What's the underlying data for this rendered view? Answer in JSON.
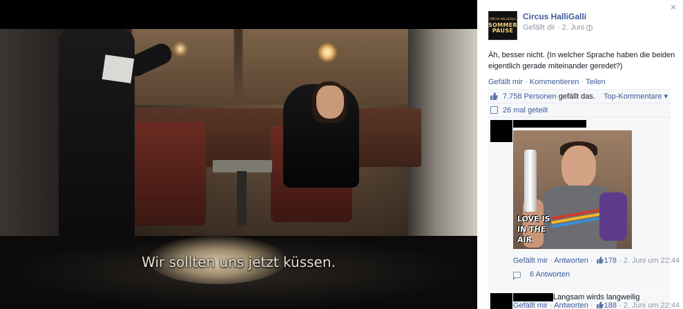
{
  "photo": {
    "subtitle": "Wir sollten uns jetzt küssen."
  },
  "sidebar": {
    "close_label": "×",
    "page": {
      "avatar_small_text": "CIRCUS HALLIGALLI",
      "avatar_line1": "SOMMER",
      "avatar_line2": "PAUSE",
      "name": "Circus HalliGalli",
      "liked": "Gefällt dir",
      "separator": "·",
      "date": "2. Juni"
    },
    "post_text": "Äh, besser nicht. (In welcher Sprache haben die beiden eigentlich gerade miteinander geredet?)",
    "actions": {
      "like": "Gefällt mir",
      "comment": "Kommentieren",
      "share": "Teilen",
      "separator": "·"
    },
    "stats": {
      "likes_count": "7.758 Personen",
      "likes_suffix": "gefällt das.",
      "sort_label": "Top-Kommentare",
      "sort_caret": "▾",
      "shares": "26 mal geteilt"
    },
    "comments": [
      {
        "meme_text": [
          "LOVE IS",
          "IN THE",
          "AIR"
        ],
        "like": "Gefällt mir",
        "reply": "Antworten",
        "like_count": "178",
        "date": "2. Juni um 22:44",
        "replies_label": "6 Antworten"
      },
      {
        "text": "Langsam wirds langweilig",
        "like": "Gefällt mir",
        "reply": "Antworten",
        "like_count": "188",
        "date": "2. Juni um 22:44"
      }
    ]
  },
  "colors": {
    "link": "#3b5998",
    "muted": "#9197a3",
    "box_bg": "#f6f7f9"
  }
}
